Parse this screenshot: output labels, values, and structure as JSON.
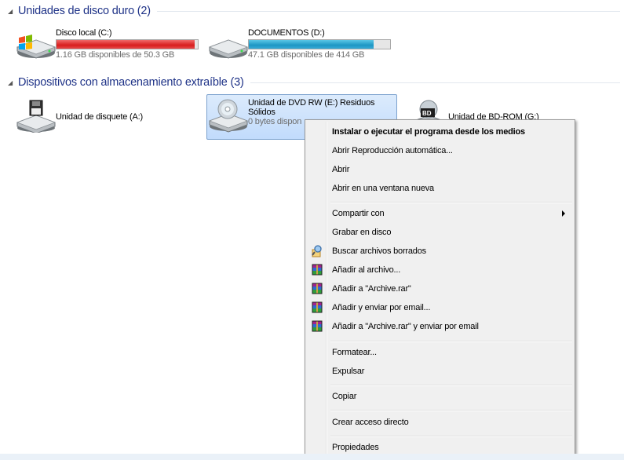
{
  "groups": {
    "hard_disks": {
      "title": "Unidades de disco duro (2)"
    },
    "removable": {
      "title": "Dispositivos con almacenamiento extraíble (3)"
    }
  },
  "drives": {
    "c": {
      "name": "Disco local (C:)",
      "free": "1.16 GB disponibles de 50.3 GB",
      "used_fraction": 0.977,
      "bar_color": "#d81e1e"
    },
    "d": {
      "name": "DOCUMENTOS (D:)",
      "free": "47.1 GB disponibles de 414 GB",
      "used_fraction": 0.886,
      "bar_color": "#1e96c4"
    },
    "a": {
      "name": "Unidad de disquete (A:)"
    },
    "e": {
      "name_line1": "Unidad de DVD RW (E:) Residuos",
      "name_line2": "Sólidos",
      "free": "0 bytes dispon"
    },
    "g": {
      "name": "Unidad de BD-ROM (G:)"
    }
  },
  "context_menu": {
    "install": "Instalar o ejecutar el programa desde los medios",
    "autoplay": "Abrir Reproducción automática...",
    "open": "Abrir",
    "open_new": "Abrir en una ventana nueva",
    "share": "Compartir con",
    "burn": "Grabar en disco",
    "search_deleted": "Buscar archivos borrados",
    "add_archive": "Añadir al archivo...",
    "add_rar": "Añadir a \"Archive.rar\"",
    "add_email": "Añadir y enviar por email...",
    "add_rar_email": "Añadir a \"Archive.rar\" y enviar por email",
    "format": "Formatear...",
    "eject": "Expulsar",
    "copy": "Copiar",
    "shortcut": "Crear acceso directo",
    "properties": "Propiedades"
  },
  "icons": {
    "hdd": "hard-drive-icon",
    "system_hdd": "windows-hard-drive-icon",
    "floppy": "floppy-drive-icon",
    "dvd": "dvd-drive-icon",
    "bd": "bd-rom-drive-icon",
    "winrar": "winrar-icon",
    "search": "search-deleted-icon"
  }
}
